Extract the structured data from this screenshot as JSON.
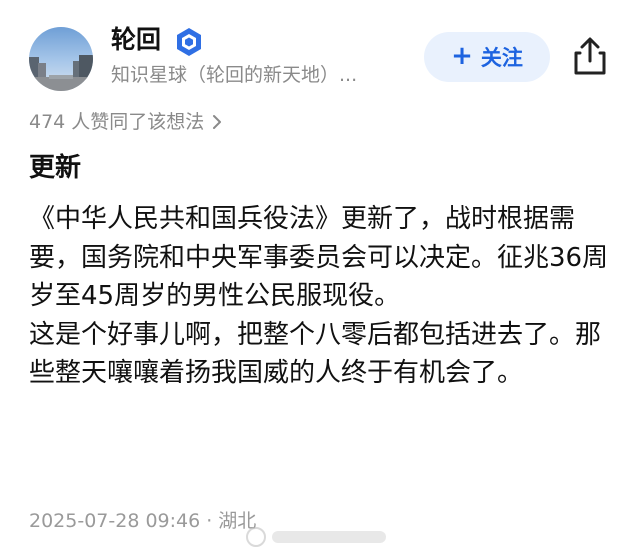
{
  "author": {
    "name": "轮回",
    "source": "知识星球（轮回的新天地）..."
  },
  "follow_button": {
    "plus": "+",
    "label": "关注"
  },
  "likes_text": "474 人赞同了该想法",
  "post": {
    "title": "更新",
    "paragraphs": [
      "《中华人民共和国兵役法》更新了，战时根据需要，国务院和中央军事委员会可以决定。征兆36周岁至45周岁的男性公民服现役。",
      "这是个好事儿啊，把整个八零后都包括进去了。那些整天嚷嚷着扬我国威的人终于有机会了。"
    ]
  },
  "footer": {
    "timestamp": "2025-07-28 09:46",
    "separator": "·",
    "location": "湖北"
  },
  "colors": {
    "accent": "#1d63e0",
    "follow_bg": "#e9f1fd",
    "muted": "#8a8a8a"
  },
  "icons": {
    "badge": "verified-badge-icon",
    "share": "share-icon",
    "chevron": "chevron-right-icon"
  }
}
